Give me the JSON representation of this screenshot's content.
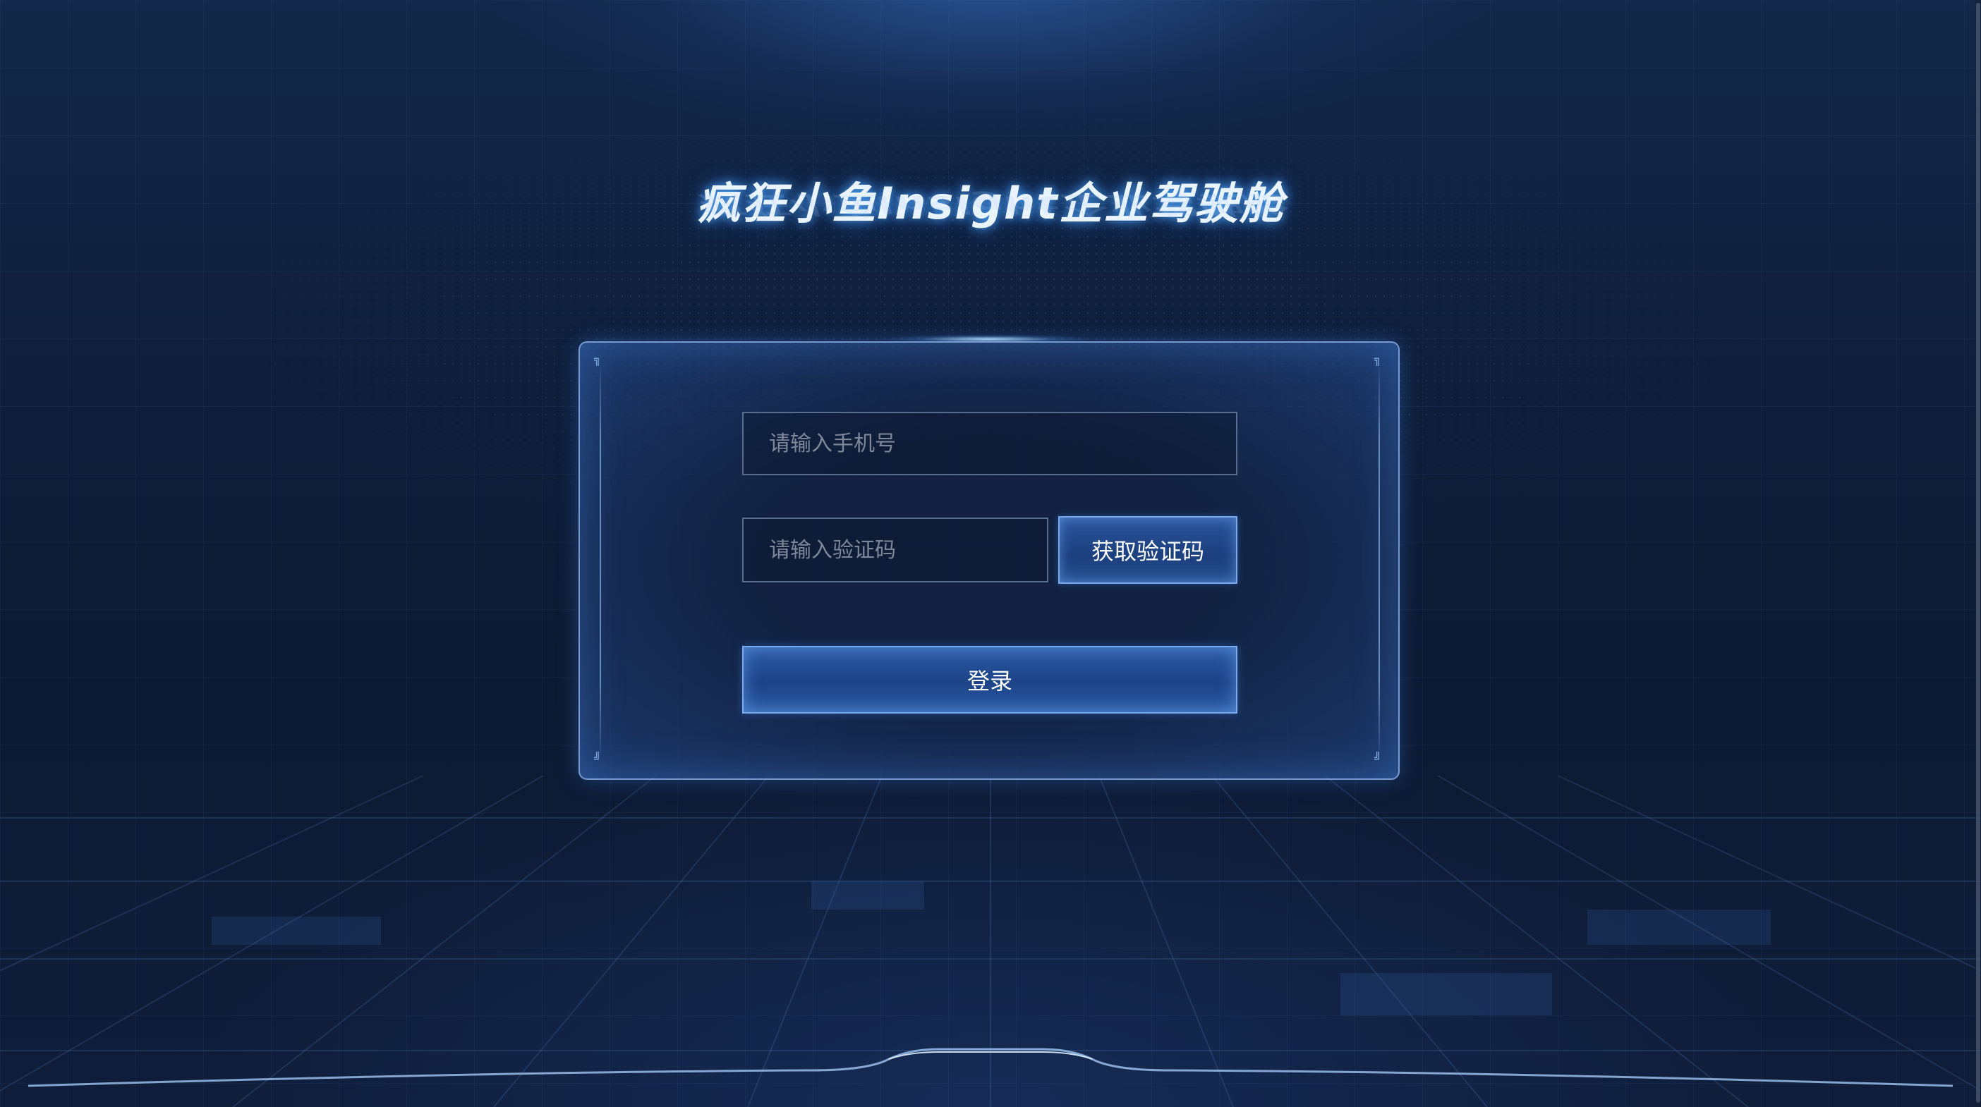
{
  "page": {
    "title": "疯狂小鱼Insight企业驾驶舱"
  },
  "login_form": {
    "phone_placeholder": "请输入手机号",
    "phone_value": "",
    "code_placeholder": "请输入验证码",
    "code_value": "",
    "get_code_label": "获取验证码",
    "login_label": "登录"
  },
  "decoration": {
    "corner_top": "╗",
    "corner_bottom": "╝"
  },
  "colors": {
    "background": "#0e1a33",
    "accent": "#2a559c",
    "title_glow": "#50aaff",
    "panel_border": "#96bef5"
  }
}
